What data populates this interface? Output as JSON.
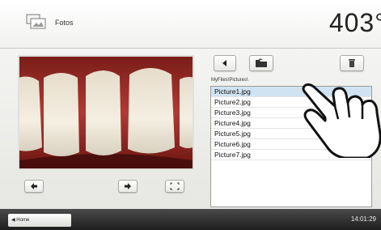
{
  "header": {
    "title": "Fotos",
    "temperature": "403°"
  },
  "file_browser": {
    "path": "MyFiles\\Pictures\\",
    "files": [
      "Picture1.jpg",
      "Picture2.jpg",
      "Picture3.jpg",
      "Picture4.jpg",
      "Picture5.jpg",
      "Picture6.jpg",
      "Picture7.jpg"
    ],
    "selected_index": 0
  },
  "footer": {
    "home_label": "Home",
    "time": "14:01:29"
  },
  "icons": {
    "app": "photos-app-icon",
    "back": "back-arrow-icon",
    "folder": "folder-icon",
    "delete": "trash-icon",
    "prev": "left-arrow-icon",
    "next": "right-arrow-icon",
    "fullscreen": "fullscreen-icon"
  }
}
